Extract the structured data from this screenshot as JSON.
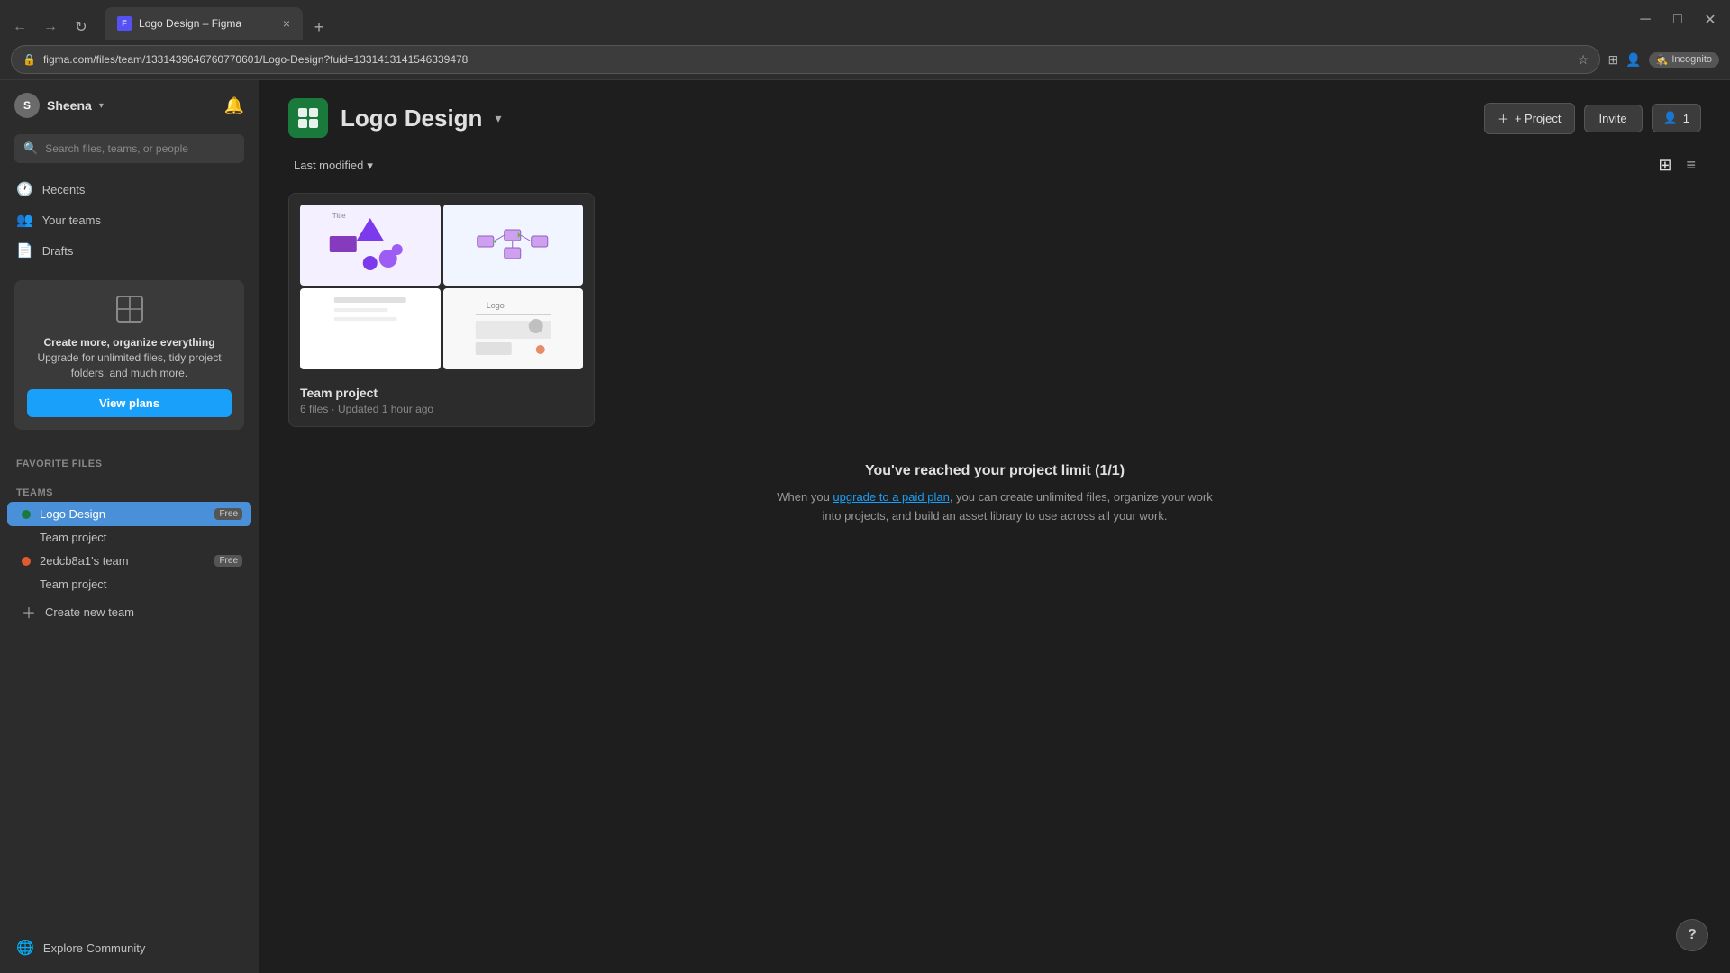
{
  "browser": {
    "tab_title": "Logo Design – Figma",
    "tab_favicon": "F",
    "address_url": "figma.com/files/team/1331439646760770601/Logo-Design?fuid=1331413141546339478",
    "new_tab_label": "+",
    "close_label": "×",
    "incognito_label": "Incognito"
  },
  "sidebar": {
    "user_name": "Sheena",
    "user_initial": "S",
    "search_placeholder": "Search files, teams, or people",
    "nav_items": [
      {
        "label": "Recents",
        "icon": "🕐"
      },
      {
        "label": "Your teams",
        "icon": "👥"
      },
      {
        "label": "Drafts",
        "icon": "📄"
      }
    ],
    "upgrade": {
      "icon": "⬛",
      "title": "Create more, organize everything",
      "description": "Upgrade for unlimited files, tidy project folders, and much more.",
      "cta": "View plans"
    },
    "sections": {
      "teams_label": "Teams",
      "favorite_files_label": "Favorite files"
    },
    "teams": [
      {
        "name": "Logo Design",
        "badge": "Free",
        "dot_color": "#1a7a3c",
        "active": true,
        "sub_items": [
          "Team project"
        ]
      },
      {
        "name": "2edcb8a1's team",
        "badge": "Free",
        "dot_color": "#e05c2c",
        "active": false,
        "sub_items": [
          "Team project"
        ]
      }
    ],
    "create_team_label": "+ Create new team",
    "community_label": "Explore Community"
  },
  "main": {
    "project_name": "Logo Design",
    "add_project_label": "+ Project",
    "invite_label": "Invite",
    "members_label": "1",
    "sort_label": "Last modified",
    "sort_icon": "▼",
    "grid_view_icon": "⊞",
    "list_view_icon": "≡",
    "project_card": {
      "name": "Team project",
      "meta": "6 files · Updated 1 hour ago"
    },
    "limit": {
      "title": "You've reached your project limit (1/1)",
      "description_before": "When you ",
      "link_text": "upgrade to a paid plan",
      "description_after": ", you can create unlimited files, organize your work into projects, and build an asset library to use across all your work."
    }
  },
  "help_btn": "?"
}
